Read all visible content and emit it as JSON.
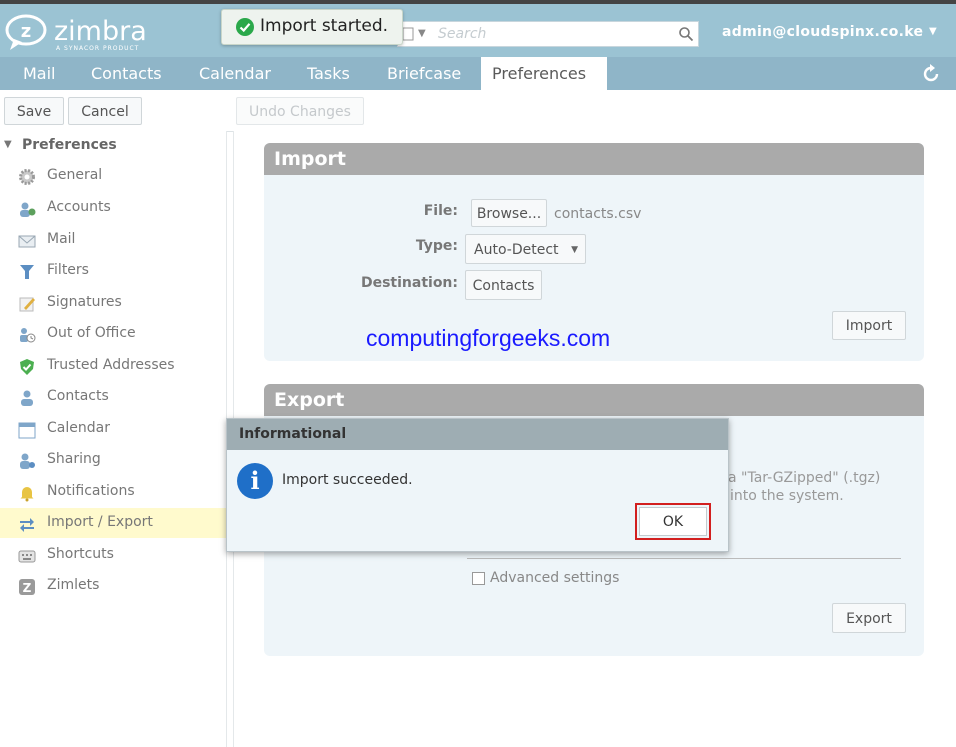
{
  "app": {
    "logo_text": "zimbra",
    "logo_subtext": "A SYNACOR PRODUCT",
    "user": "admin@cloudspinx.co.ke"
  },
  "toast": {
    "message": "Import started."
  },
  "search": {
    "placeholder": "Search"
  },
  "tabs": [
    {
      "label": "Mail"
    },
    {
      "label": "Contacts"
    },
    {
      "label": "Calendar"
    },
    {
      "label": "Tasks"
    },
    {
      "label": "Briefcase"
    },
    {
      "label": "Preferences",
      "active": true
    }
  ],
  "toolbar": {
    "save_label": "Save",
    "cancel_label": "Cancel",
    "undo_label": "Undo Changes"
  },
  "sidebar": {
    "header": "Preferences",
    "items": [
      {
        "label": "General",
        "icon": "gear-icon"
      },
      {
        "label": "Accounts",
        "icon": "accounts-icon"
      },
      {
        "label": "Mail",
        "icon": "mail-icon"
      },
      {
        "label": "Filters",
        "icon": "filter-icon"
      },
      {
        "label": "Signatures",
        "icon": "signature-icon"
      },
      {
        "label": "Out of Office",
        "icon": "out-of-office-icon"
      },
      {
        "label": "Trusted Addresses",
        "icon": "shield-icon"
      },
      {
        "label": "Contacts",
        "icon": "contact-icon"
      },
      {
        "label": "Calendar",
        "icon": "calendar-icon"
      },
      {
        "label": "Sharing",
        "icon": "sharing-icon"
      },
      {
        "label": "Notifications",
        "icon": "bell-icon"
      },
      {
        "label": "Import / Export",
        "icon": "import-export-icon",
        "active": true
      },
      {
        "label": "Shortcuts",
        "icon": "keyboard-icon"
      },
      {
        "label": "Zimlets",
        "icon": "zimlet-icon"
      }
    ]
  },
  "import_panel": {
    "title": "Import",
    "file_label": "File:",
    "browse_label": "Browse...",
    "file_name": "contacts.csv",
    "type_label": "Type:",
    "type_value": "Auto-Detect",
    "destination_label": "Destination:",
    "destination_value": "Contacts",
    "import_button": "Import"
  },
  "watermark": "computingforgeeks.com",
  "export_panel": {
    "title": "Export",
    "partial_text_1": "a \"Tar-GZipped\" (.tgz)",
    "partial_text_2": "into the system.",
    "advanced_label": "Advanced settings",
    "export_button": "Export"
  },
  "dialog": {
    "title": "Informational",
    "message": "Import succeeded.",
    "ok_label": "OK"
  },
  "colors": {
    "header_bg": "#9bc3d3",
    "tab_bg": "#8fb5c8",
    "panel_bg": "#eef5f9",
    "panel_head": "#aaaaaa",
    "dialog_title_bg": "#9eadb3",
    "highlight": "#d21f1f",
    "active_item": "#fffacd",
    "watermark": "#1a1aff"
  }
}
